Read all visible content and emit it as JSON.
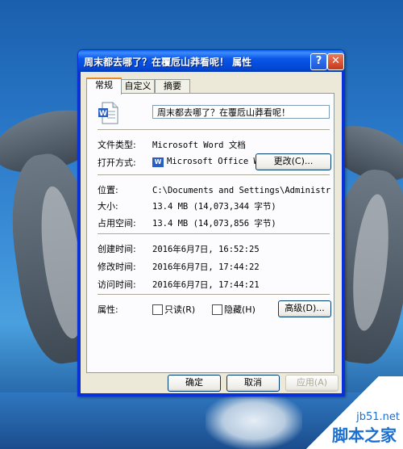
{
  "window": {
    "title": "周末都去哪了？在覆卮山莽看呢！ 属性",
    "help_glyph": "?",
    "close_glyph": "✕"
  },
  "tabs": [
    {
      "label": "常规"
    },
    {
      "label": "自定义"
    },
    {
      "label": "摘要"
    }
  ],
  "general": {
    "file_name": "周末都去哪了？在覆卮山莽看呢！",
    "file_type_label": "文件类型:",
    "file_type_value": "Microsoft Word 文档",
    "open_with_label": "打开方式:",
    "open_with_value": "Microsoft Office Wo",
    "change_button": "更改(C)...",
    "location_label": "位置:",
    "location_value": "C:\\Documents and Settings\\Administrator\\桌",
    "size_label": "大小:",
    "size_value": "13.4 MB (14,073,344 字节)",
    "size_on_disk_label": "占用空间:",
    "size_on_disk_value": "13.4 MB (14,073,856 字节)",
    "created_label": "创建时间:",
    "created_value": "2016年6月7日, 16:52:25",
    "modified_label": "修改时间:",
    "modified_value": "2016年6月7日, 17:44:22",
    "accessed_label": "访问时间:",
    "accessed_value": "2016年6月7日, 17:44:21",
    "attributes_label": "属性:",
    "readonly_label": "只读(R)",
    "hidden_label": "隐藏(H)",
    "advanced_button": "高级(D)...",
    "word_icon_letter": "W"
  },
  "footer": {
    "ok": "确定",
    "cancel": "取消",
    "apply": "应用(A)"
  },
  "watermark": {
    "site": "jb51.net",
    "brand": "脚本之家"
  },
  "colors": {
    "titlebar": "#0a5ff2",
    "frame": "#0831d9",
    "dialog_bg": "#ece9d8",
    "watermark": "#1b6fd1"
  },
  "icons": {
    "file": "word-document-icon",
    "app": "word-app-icon"
  }
}
